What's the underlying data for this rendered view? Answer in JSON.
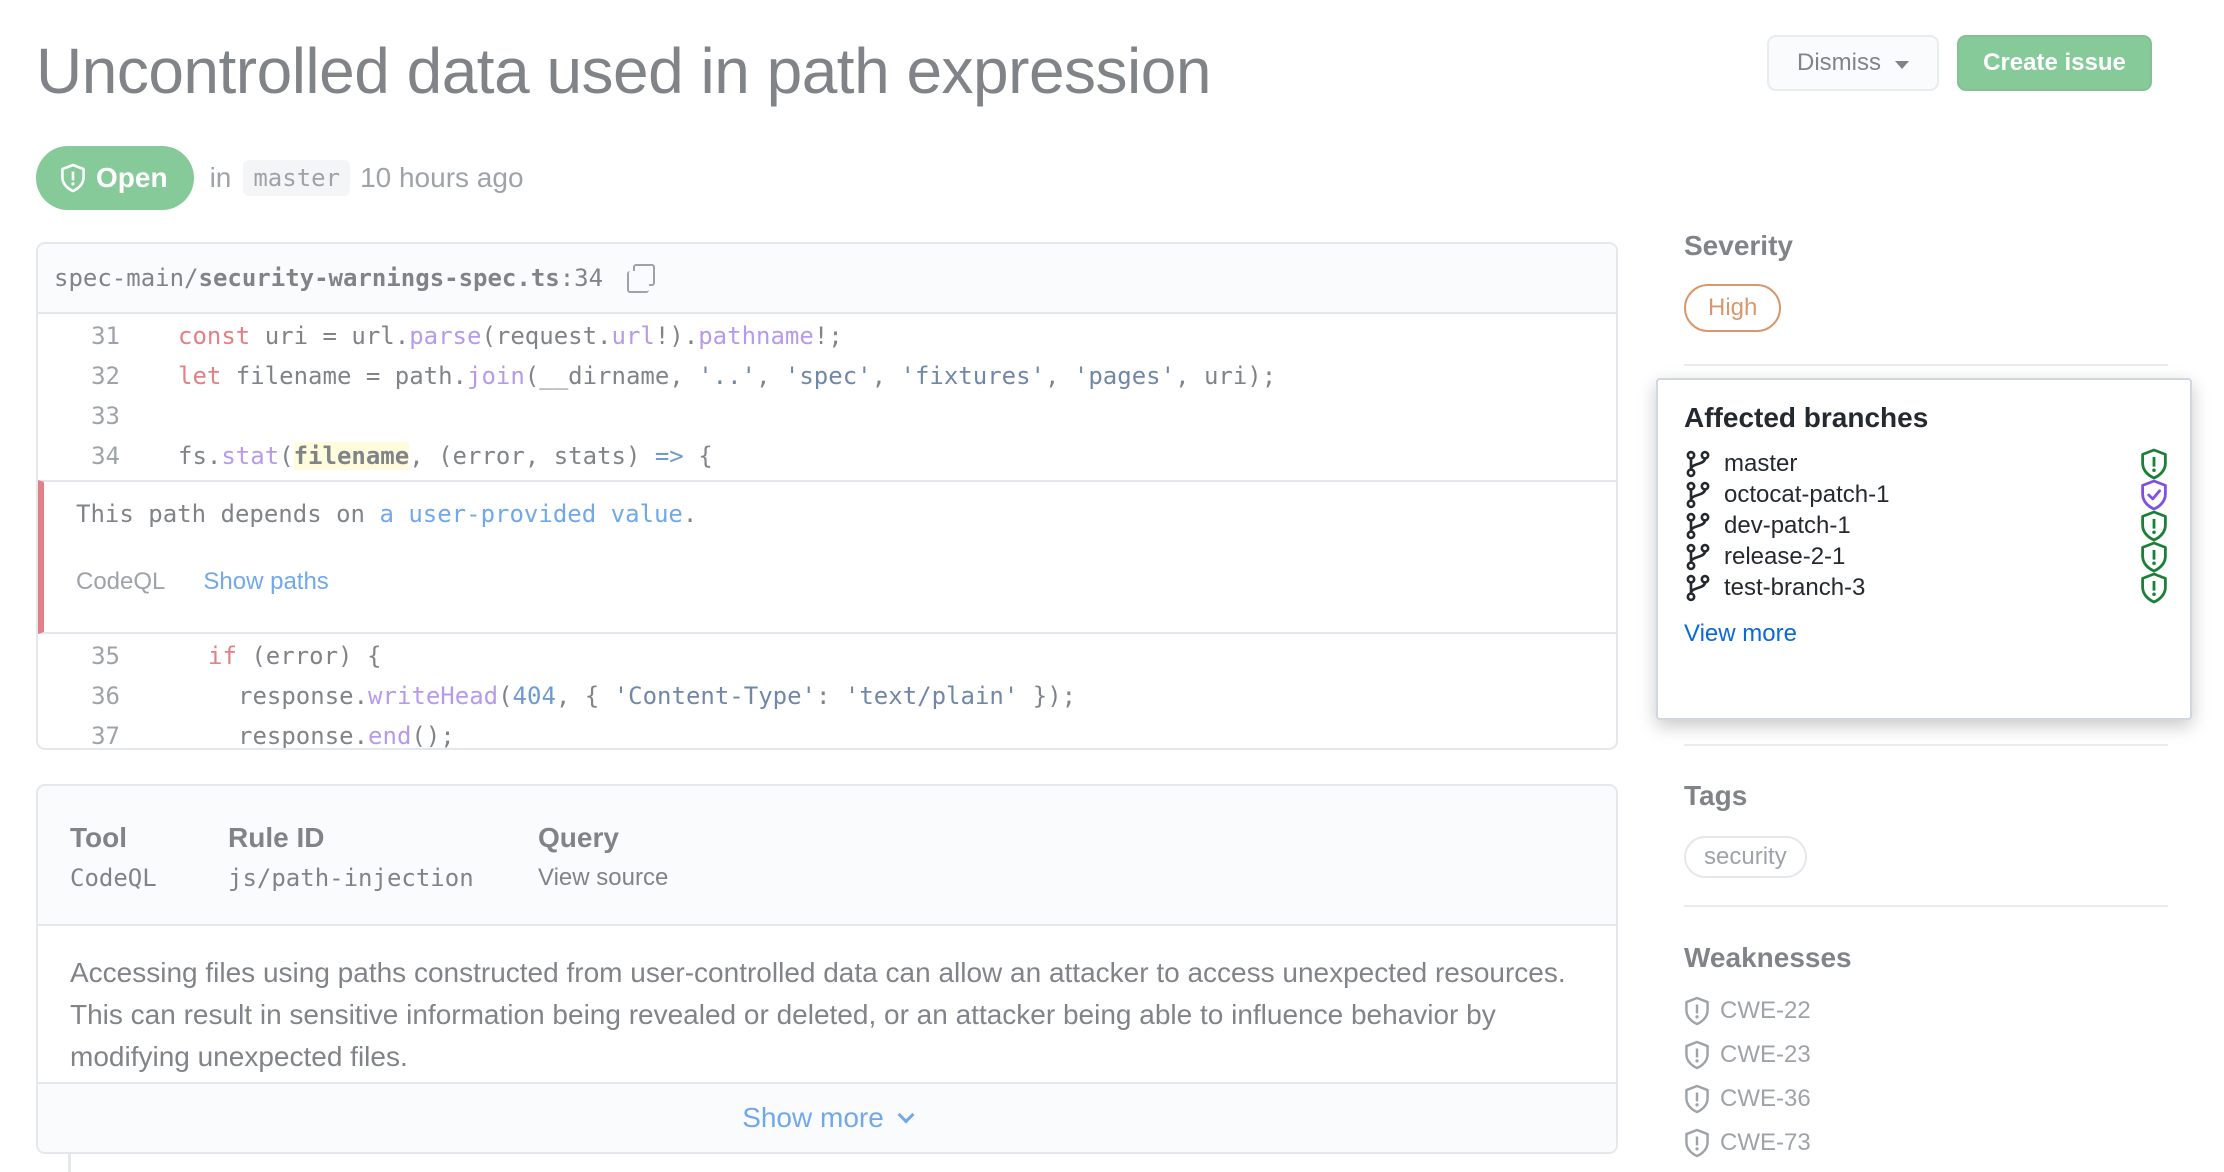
{
  "alert": {
    "title": "Uncontrolled data used in path expression",
    "status": "Open",
    "in_label": "in",
    "branch": "master",
    "time_ago": "10 hours ago"
  },
  "header_actions": {
    "dismiss_label": "Dismiss",
    "create_issue_label": "Create issue"
  },
  "code": {
    "file_dir": "spec-main/",
    "file_name": "security-warnings-spec.ts",
    "file_line": ":34",
    "lines_before": [
      {
        "num": "31",
        "text": "const uri = url.parse(request.url!).pathname!;"
      },
      {
        "num": "32",
        "text": "let filename = path.join(__dirname, '..', 'spec', 'fixtures', 'pages', uri);"
      },
      {
        "num": "33",
        "text": ""
      },
      {
        "num": "34",
        "text": "fs.stat(filename, (error, stats) => {"
      }
    ],
    "lines_after": [
      {
        "num": "35",
        "text": "if (error) {"
      },
      {
        "num": "36",
        "text": "response.writeHead(404, { 'Content-Type': 'text/plain' });"
      },
      {
        "num": "37",
        "text": "response.end();"
      }
    ],
    "message_prefix": "This path depends on ",
    "message_link": "a user-provided value",
    "message_suffix": ".",
    "tool": "CodeQL",
    "show_paths": "Show paths"
  },
  "details": {
    "tool_heading": "Tool",
    "tool_value": "CodeQL",
    "rule_heading": "Rule ID",
    "rule_value": "js/path-injection",
    "query_heading": "Query",
    "query_value": "View source",
    "description": "Accessing files using paths constructed from user-controlled data can allow an attacker to access unexpected resources. This can result in sensitive information being revealed or deleted, or an attacker being able to influence behavior by modifying unexpected files.",
    "show_more": "Show more"
  },
  "sidebar": {
    "severity_heading": "Severity",
    "severity_value": "High",
    "tags_heading": "Tags",
    "tag": "security",
    "weaknesses_heading": "Weaknesses",
    "weaknesses": [
      "CWE-22",
      "CWE-23",
      "CWE-36",
      "CWE-73"
    ]
  },
  "popover": {
    "title": "Affected branches",
    "branches": [
      {
        "name": "master",
        "status": "open"
      },
      {
        "name": "octocat-patch-1",
        "status": "fixed"
      },
      {
        "name": "dev-patch-1",
        "status": "open"
      },
      {
        "name": "release-2-1",
        "status": "open"
      },
      {
        "name": "test-branch-3",
        "status": "open"
      }
    ],
    "view_more": "View more"
  },
  "colors": {
    "open_green": "#2da44e",
    "severity_high": "#bc4c00",
    "fixed_purple": "#8250df",
    "link_blue": "#0969da",
    "alert_red": "#cf222e"
  },
  "icons": {
    "status": "shield-alert-icon",
    "branch": "git-branch-icon",
    "fixed": "shield-check-icon",
    "copy": "copy-icon",
    "caret": "caret-down-icon",
    "chevron": "chevron-down-icon"
  }
}
